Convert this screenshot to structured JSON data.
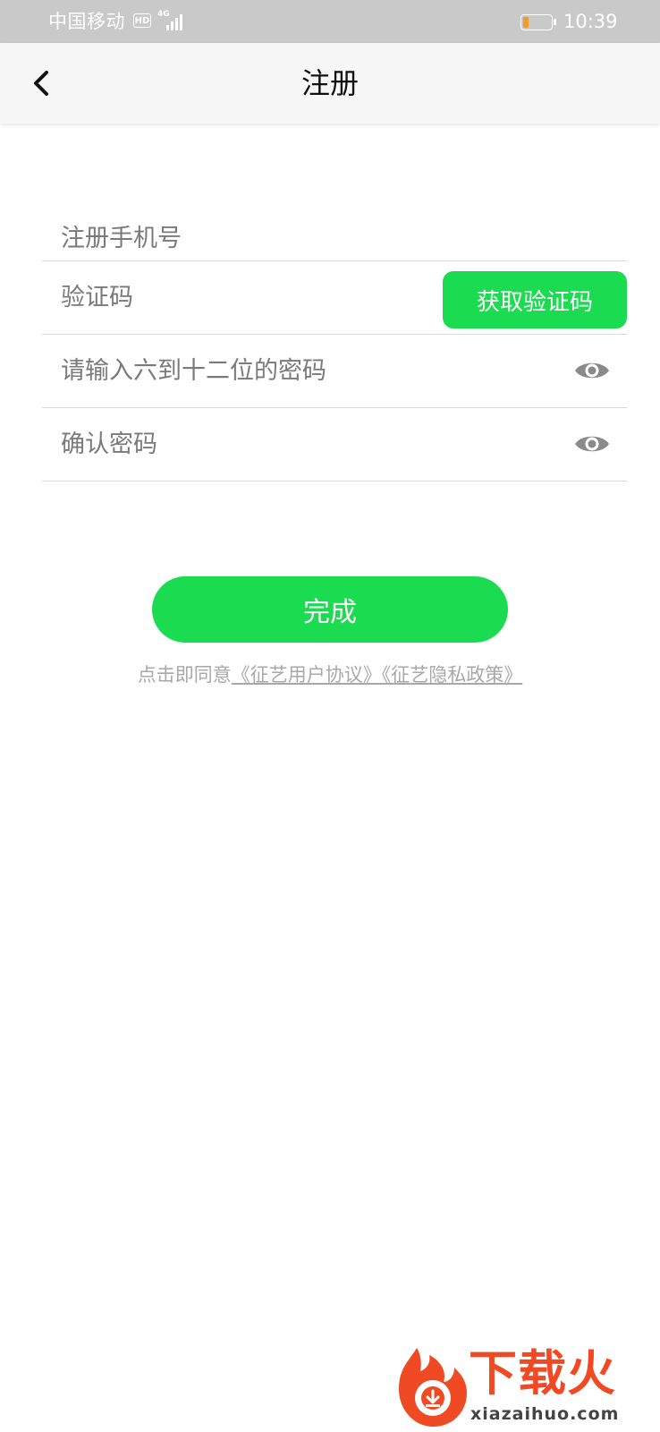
{
  "status_bar": {
    "carrier": "中国移动",
    "hd_badge": "HD",
    "network_type": "4G",
    "time": "10:39",
    "battery_level": 0.2,
    "battery_color": "#f39a2b"
  },
  "nav": {
    "title": "注册",
    "back_icon": "chevron-left-icon"
  },
  "form": {
    "phone_placeholder": "注册手机号",
    "code_placeholder": "验证码",
    "get_code_label": "获取验证码",
    "password_placeholder": "请输入六到十二位的密码",
    "confirm_password_placeholder": "确认密码",
    "password_toggle_icon": "eye-icon"
  },
  "submit_label": "完成",
  "agreement": {
    "prefix": "点击即同意",
    "user_agreement": "《征艺用户协议》",
    "privacy_policy": "《征艺隐私政策》"
  },
  "watermark": {
    "title": "下载火",
    "url": "xiazaihuo.com"
  },
  "colors": {
    "accent_green": "#1bdb50",
    "watermark_orange": "#f04a25"
  }
}
